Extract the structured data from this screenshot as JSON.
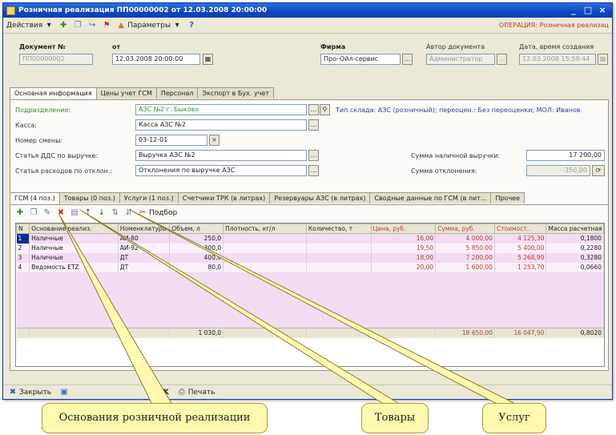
{
  "window": {
    "title": "Розничная реализация ПП00000002 от 12.03.2008 20:00:00",
    "controls": {
      "minimize": "_",
      "maximize": "□",
      "close": "×"
    }
  },
  "toolbar": {
    "actions_label": "Действия",
    "params_label": "Параметры",
    "help_label": "?",
    "operation_label": "ОПЕРАЦИЯ: Розничная реализац"
  },
  "header": {
    "doc_number_label": "Документ №",
    "doc_number_value": "ПП00000002",
    "from_label": "от",
    "date_value": "12.03.2008 20:00:00",
    "firm_label": "Фирма",
    "firm_value": "Про–Ойл-сервис",
    "author_label": "Автор документа",
    "author_value": "Администратор",
    "created_label": "Дата, время создания",
    "created_value": "12.03.2008 15:59:44"
  },
  "top_tabs": [
    {
      "label": "Основная информация",
      "active": true
    },
    {
      "label": "Цены учет ГСМ",
      "active": false
    },
    {
      "label": "Персонал",
      "active": false
    },
    {
      "label": "Экспорт в Бух. учет",
      "active": false
    }
  ],
  "form": {
    "division_label": "Подразделение:",
    "division_value": "АЗС №2 г. Быково",
    "division_info": "Тип склада: АЗС (розничный); переоцен.: Без переоценки; МОЛ: Иванов",
    "cash_label": "Касса:",
    "cash_value": "Касса АЗС №2",
    "shift_label": "Номер смены:",
    "shift_value": "03-12-01",
    "dds_label": "Статья ДДС по выручке:",
    "dds_value": "Выручка АЗС №2",
    "expense_label": "Статья расходов по отклон.:",
    "expense_value": "Отклонения по выручке АЗС",
    "cash_revenue_label": "Сумма наличной выручки:",
    "cash_revenue_value": "17 200,00",
    "deviation_label": "Сумма отклонения:",
    "deviation_value": "-350,00"
  },
  "sub_tabs": [
    {
      "label": "ГСМ (4 поз.)",
      "active": true
    },
    {
      "label": "Товары (0 поз.)",
      "active": false
    },
    {
      "label": "Услуги (1 поз.)",
      "active": false
    },
    {
      "label": "Счетчики ТРК (в литрах)",
      "active": false
    },
    {
      "label": "Резервуары АЗС (в литрах)",
      "active": false
    },
    {
      "label": "Сводные данные по ГСМ (в лит...",
      "active": false
    },
    {
      "label": "Прочее",
      "active": false
    }
  ],
  "grid_toolbar": {
    "select_label": "Подбор"
  },
  "grid": {
    "columns": [
      "N",
      "Основание реализ.",
      "Номенклатура",
      "Объем, л",
      "Плотность, кг/л",
      "Количество, т",
      "Цена, руб.",
      "Сумма, руб.",
      "Стоимост..",
      "Масса расчетная"
    ],
    "rows": [
      [
        "1",
        "Наличные",
        "АИ-80",
        "250,0",
        "",
        "",
        "16,00",
        "4 000,00",
        "4 125,30",
        "0,1800"
      ],
      [
        "2",
        "Наличные",
        "АИ-92",
        "300,0",
        "",
        "",
        "19,50",
        "5 850,00",
        "5 400,00",
        "0,2280"
      ],
      [
        "3",
        "Наличные",
        "ДТ",
        "400,0",
        "",
        "",
        "18,00",
        "7 200,00",
        "5 268,90",
        "0,3280"
      ],
      [
        "4",
        "Ведомость ЕТZ",
        "ДТ",
        "80,0",
        "",
        "",
        "20,00",
        "1 600,00",
        "1 253,70",
        "0,0660"
      ]
    ],
    "totals": [
      "",
      "",
      "",
      "1 030,0",
      "",
      "",
      "",
      "18 650,00",
      "16 047,90",
      "0,8020"
    ]
  },
  "bottom": {
    "close_label": "Закрыть",
    "ok_label": "OK",
    "print_label": "Печать"
  },
  "callouts": {
    "bases": "Основания розничной реализации",
    "goods": "Товары",
    "services": "Услуг"
  },
  "colors": {
    "title_bar": "#0b47c2",
    "row_highlight": "#f3ddf3",
    "callout_fill": "#fff9b0",
    "operation_text": "#c0392b"
  }
}
